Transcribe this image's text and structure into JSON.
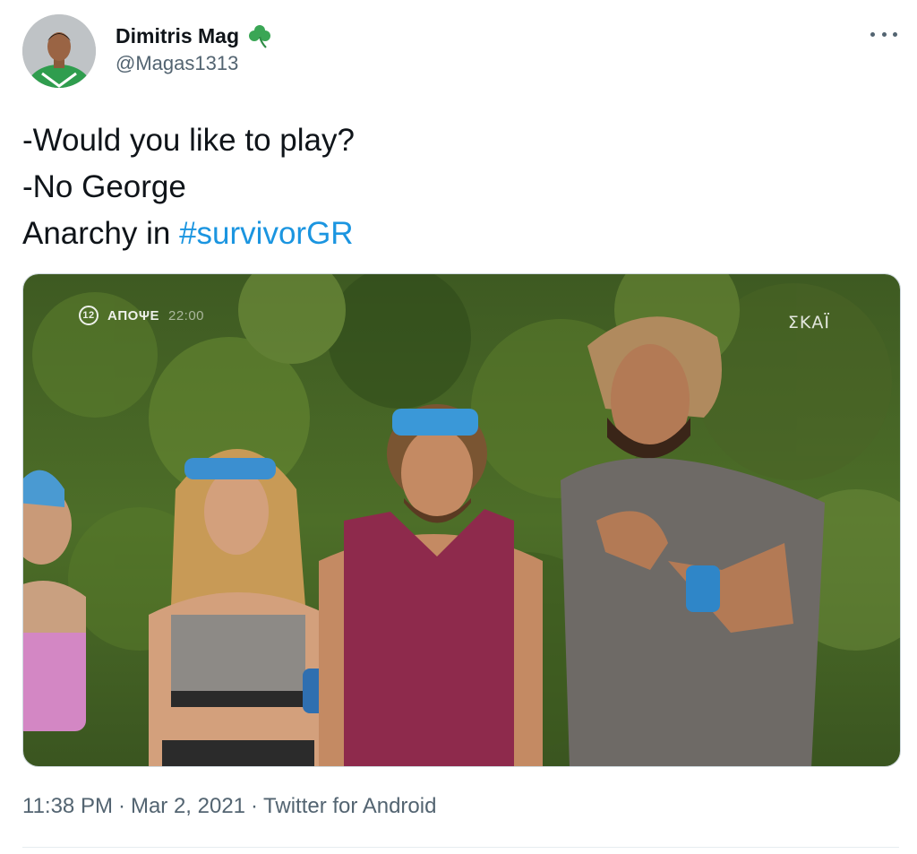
{
  "tweet": {
    "display_name": "Dimitris Mag",
    "handle": "@Magas1313",
    "lines": [
      "-Would you like to play?",
      "-No George",
      "Anarchy in "
    ],
    "hashtag": "#survivorGR",
    "timestamp": "11:38 PM",
    "date": "Mar 2, 2021",
    "source": "Twitter for Android",
    "separator": "·"
  },
  "media": {
    "channel_badge": "12",
    "promo_label": "ΑΠΟΨΕ",
    "promo_time": "22:00",
    "broadcaster_logo": "ΣΚΑΪ"
  },
  "icons": {
    "verified_emoji": "shamrock-icon",
    "more": "more-options-icon"
  },
  "colors": {
    "hashtag": "#1b95e0",
    "secondary_text": "#536471",
    "primary_text": "#0f1419"
  }
}
